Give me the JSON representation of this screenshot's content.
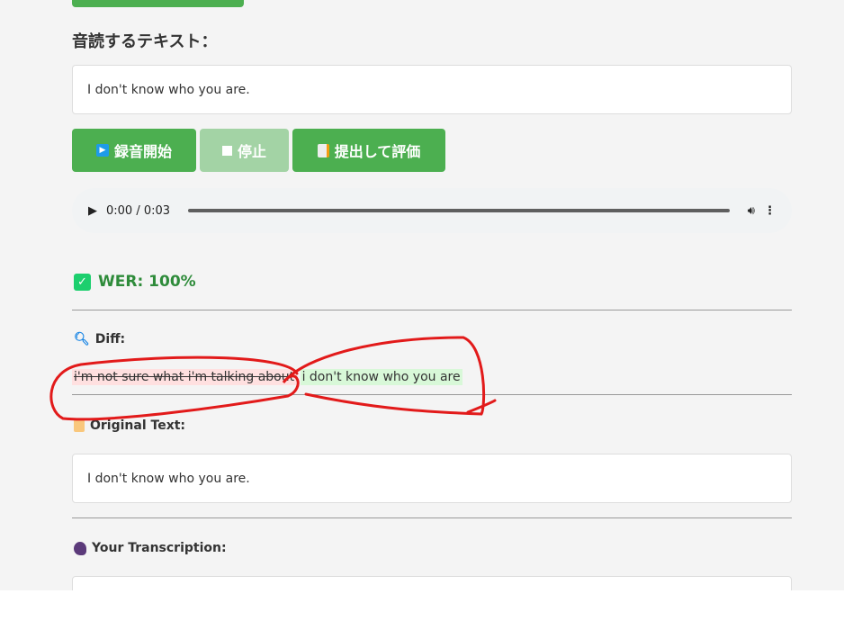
{
  "heading": "音読するテキスト：",
  "target_text": "I don't know who you are.",
  "buttons": {
    "record": "録音開始",
    "stop": "停止",
    "submit": "提出して評価"
  },
  "audio": {
    "time": "0:00 / 0:03"
  },
  "result": {
    "wer": "WER: 100%",
    "wer_color": "#2e8b3a"
  },
  "diff": {
    "label": "Diff:",
    "deleted": "i'm not sure what i'm talking about",
    "inserted": "i don't know who you are"
  },
  "original": {
    "label": "Original Text:",
    "text": "I don't know who you are."
  },
  "transcription": {
    "label": "Your Transcription:"
  }
}
